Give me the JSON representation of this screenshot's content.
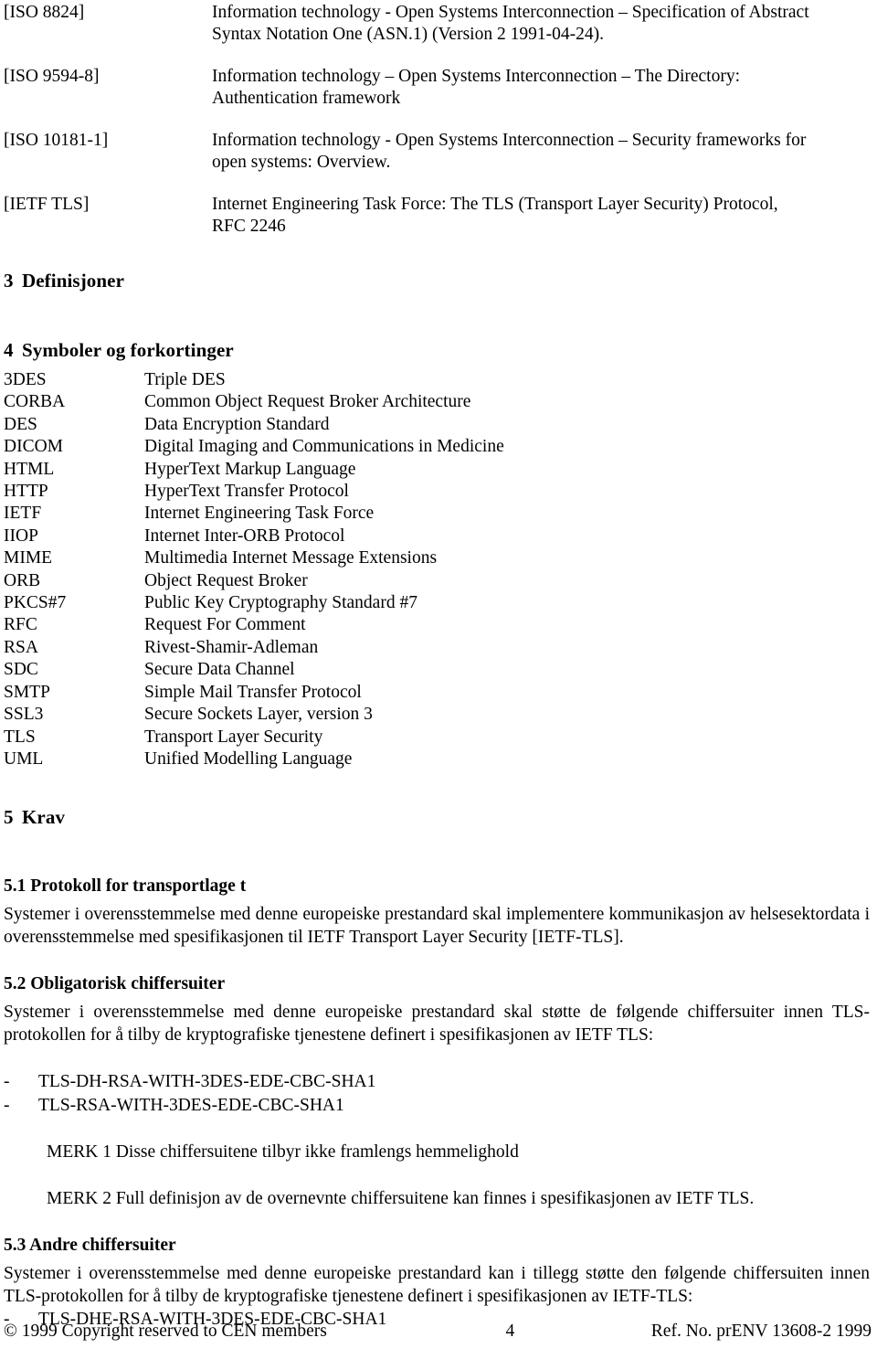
{
  "references": [
    {
      "key": "[ISO 8824]",
      "lines": [
        "Information technology - Open Systems Interconnection – Specification of Abstract",
        "Syntax Notation One (ASN.1) (Version 2 1991-04-24)."
      ],
      "justified": true
    },
    {
      "key": "[ISO 9594-8]",
      "lines": [
        "Information technology – Open Systems Interconnection – The Directory:",
        "Authentication framework"
      ],
      "justified": true
    },
    {
      "key": "[ISO 10181-1]",
      "lines": [
        "Information technology - Open Systems Interconnection – Security frameworks for",
        "open systems: Overview."
      ],
      "justified": true
    },
    {
      "key": "[IETF TLS]",
      "lines": [
        "Internet Engineering Task Force: The TLS (Transport Layer Security) Protocol,",
        "RFC 2246"
      ],
      "justified": false
    }
  ],
  "section3": {
    "number": "3",
    "title": "Definisjoner"
  },
  "section4": {
    "number": "4",
    "title": "Symboler og forkortinger",
    "abbreviations": [
      {
        "abbr": "3DES",
        "meaning": "Triple DES"
      },
      {
        "abbr": "CORBA",
        "meaning": "Common Object Request Broker Architecture"
      },
      {
        "abbr": "DES",
        "meaning": "Data Encryption Standard"
      },
      {
        "abbr": "DICOM",
        "meaning": "Digital Imaging and Communications in Medicine"
      },
      {
        "abbr": "HTML",
        "meaning": "HyperText Markup Language"
      },
      {
        "abbr": "HTTP",
        "meaning": "HyperText Transfer Protocol"
      },
      {
        "abbr": "IETF",
        "meaning": "Internet Engineering Task Force"
      },
      {
        "abbr": "IIOP",
        "meaning": "Internet Inter-ORB Protocol"
      },
      {
        "abbr": "MIME",
        "meaning": "Multimedia Internet Message Extensions"
      },
      {
        "abbr": "ORB",
        "meaning": "Object Request Broker"
      },
      {
        "abbr": "PKCS#7",
        "meaning": "Public Key Cryptography Standard #7"
      },
      {
        "abbr": "RFC",
        "meaning": "Request For Comment"
      },
      {
        "abbr": "RSA",
        "meaning": "Rivest-Shamir-Adleman"
      },
      {
        "abbr": "SDC",
        "meaning": "Secure Data Channel"
      },
      {
        "abbr": "SMTP",
        "meaning": "Simple Mail Transfer Protocol"
      },
      {
        "abbr": "SSL3",
        "meaning": "Secure Sockets Layer, version 3"
      },
      {
        "abbr": "TLS",
        "meaning": "Transport Layer Security"
      },
      {
        "abbr": "UML",
        "meaning": "Unified Modelling Language"
      }
    ]
  },
  "section5": {
    "number": "5",
    "title": "Krav",
    "sub1": {
      "heading": "5.1 Protokoll for transportlage t",
      "paragraph": "Systemer i overensstemmelse med denne europeiske prestandard skal implementere kommunikasjon av helsesektordata i overensstemmelse med spesifikasjonen til IETF Transport Layer Security [IETF-TLS]."
    },
    "sub2": {
      "heading": "5.2 Obligatorisk chiffersuiter",
      "paragraph": "Systemer i overensstemmelse med denne europeiske prestandard skal støtte de følgende chiffersuiter innen TLS-protokollen for å tilby de kryptografiske tjenestene definert i spesifikasjonen av IETF TLS:",
      "bullet_marker": "-",
      "cipher_suites": [
        "TLS-DH-RSA-WITH-3DES-EDE-CBC-SHA1",
        "TLS-RSA-WITH-3DES-EDE-CBC-SHA1"
      ],
      "note1": "MERK  1 Disse chiffersuitene tilbyr ikke framlengs hemmelighold",
      "note2": "MERK  2 Full definisjon av de overnevnte chiffersuitene kan finnes i spesifikasjonen av IETF TLS."
    },
    "sub3": {
      "heading": "5.3 Andre chiffersuiter",
      "paragraph": "Systemer i overensstemmelse med denne europeiske prestandard kan i tillegg støtte den følgende chiffersuiten innen TLS-protokollen for å tilby de kryptografiske tjenestene definert i spesifikasjonen av IETF-TLS:",
      "bullet_marker": "-",
      "cipher_suites": [
        "TLS-DHE-RSA-WITH-3DES-EDE-CBC-SHA1"
      ]
    }
  },
  "footer": {
    "copyright": "© 1999 Copyright reserved to CEN members",
    "page_number": "4",
    "reference": "Ref. No. prENV 13608-2 1999"
  }
}
